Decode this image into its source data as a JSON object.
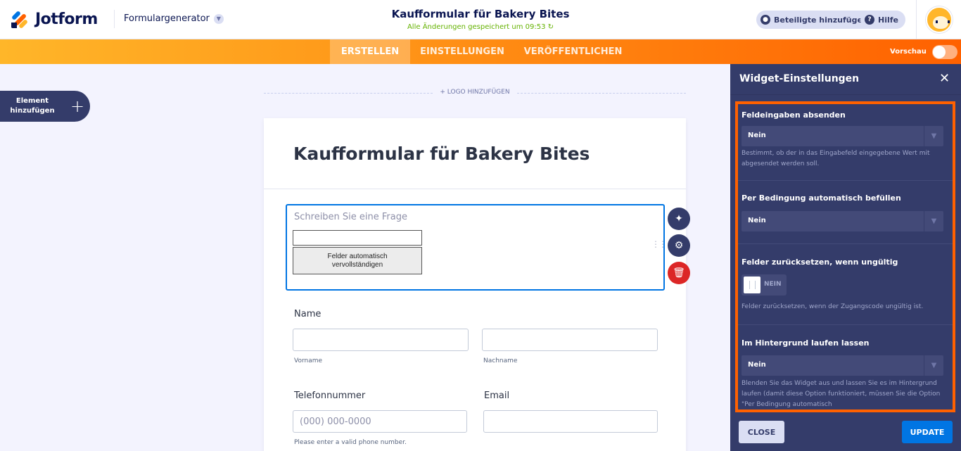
{
  "header": {
    "brand": "Jotform",
    "generator": "Formulargenerator",
    "form_title": "Kaufformular für Bakery Bites",
    "saved_status": "Alle Änderungen gespeichert um 09:53",
    "add_participants": "Beteiligte hinzufügen",
    "help": "Hilfe"
  },
  "nav": {
    "tabs": [
      "ERSTELLEN",
      "EINSTELLUNGEN",
      "VERÖFFENTLICHEN"
    ],
    "active_tab": "ERSTELLEN",
    "preview_label": "Vorschau"
  },
  "left": {
    "add_element_line1": "Element",
    "add_element_line2": "hinzufügen"
  },
  "canvas": {
    "add_logo": "+ LOGO HINZUFÜGEN",
    "form_heading": "Kaufformular für Bakery Bites",
    "widget": {
      "question_placeholder": "Schreiben Sie eine Frage",
      "button_line1": "Felder automatisch",
      "button_line2": "vervollständigen"
    },
    "name_label": "Name",
    "first_name_sub": "Vorname",
    "last_name_sub": "Nachname",
    "phone_label": "Telefonnummer",
    "phone_placeholder": "(000) 000-0000",
    "phone_hint": "Please enter a valid phone number.",
    "email_label": "Email"
  },
  "panel": {
    "title": "Widget-Einstellungen",
    "sections": [
      {
        "title": "Feldeingaben absenden",
        "value": "Nein",
        "description": "Bestimmt, ob der in das Eingabefeld eingegebene Wert mit abgesendet werden soll."
      },
      {
        "title": "Per Bedingung automatisch befüllen",
        "value": "Nein"
      },
      {
        "title": "Felder zurücksetzen, wenn ungültig",
        "toggle_text": "NEIN",
        "description": "Felder zurücksetzen, wenn der Zugangscode ungültig ist."
      },
      {
        "title": "Im Hintergrund laufen lassen",
        "value": "Nein",
        "description": "Blenden Sie das Widget aus und lassen Sie es im Hintergrund laufen (damit diese Option funktioniert, müssen Sie die Option \"Per Bedingung automatisch"
      }
    ],
    "close_button": "CLOSE",
    "update_button": "UPDATE"
  },
  "colors": {
    "accent_orange": "#ff6100",
    "accent_blue": "#0075e3",
    "panel_bg": "#343c6a",
    "delete_red": "#dc2626"
  }
}
